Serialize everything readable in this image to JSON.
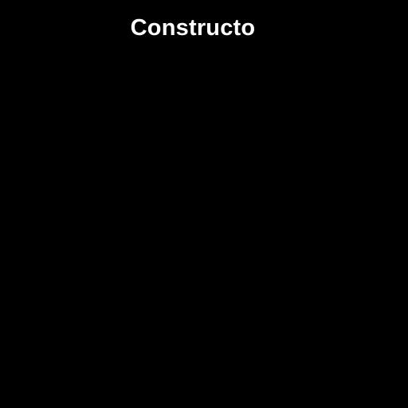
{
  "app": {
    "title": "Constructo"
  },
  "colors": {
    "background": "#000000",
    "title_text": "#ffffff"
  }
}
